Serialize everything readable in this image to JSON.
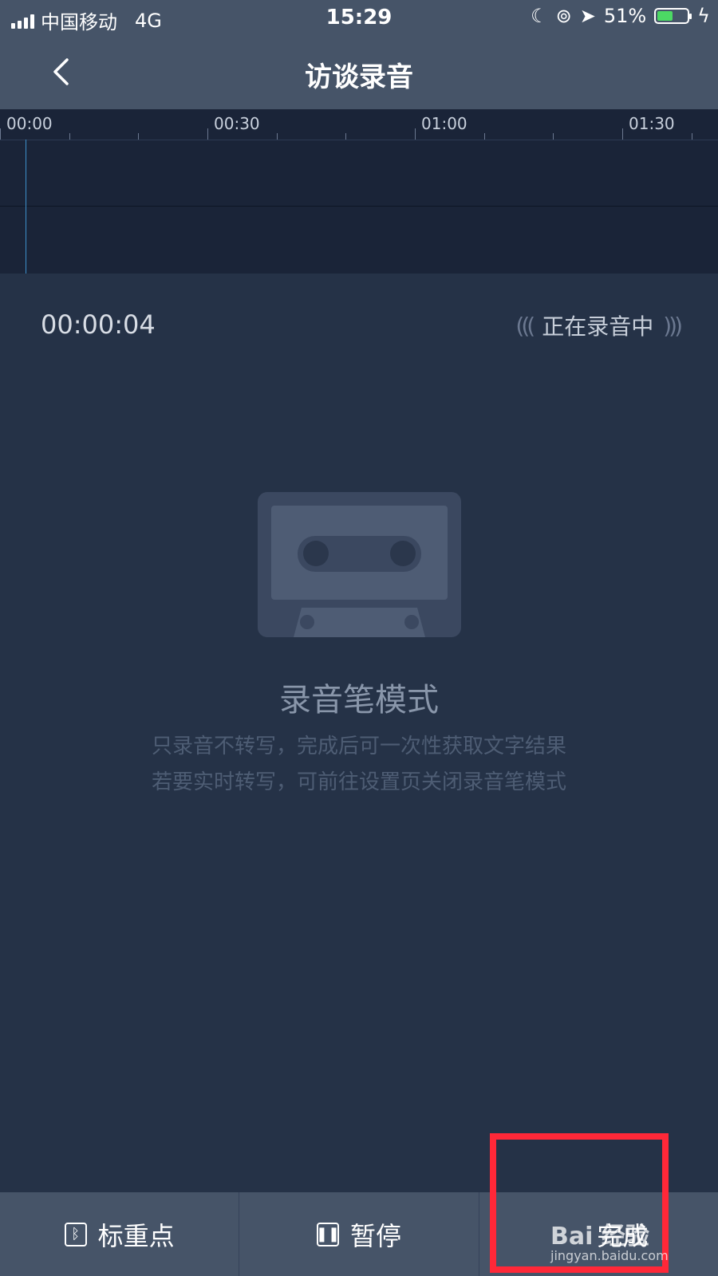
{
  "status": {
    "carrier": "中国移动",
    "network": "4G",
    "time": "15:29",
    "battery": "51%",
    "battery_level": 0.51
  },
  "nav": {
    "title": "访谈录音",
    "back_icon": "chevron-left-icon"
  },
  "timeline": {
    "labels": [
      "00:00",
      "00:30",
      "01:00",
      "01:30"
    ]
  },
  "recording": {
    "elapsed": "00:00:04",
    "status": "正在录音中"
  },
  "mode": {
    "title": "录音笔模式",
    "desc_line1": "只录音不转写，完成后可一次性获取文字结果",
    "desc_line2": "若要实时转写，可前往设置页关闭录音笔模式"
  },
  "bottom": {
    "mark_label": "标重点",
    "pause_label": "暂停",
    "done_label": "完成"
  },
  "watermark": {
    "text": "Bai 经验",
    "url": "jingyan.baidu.com"
  },
  "colors": {
    "accent_highlight": "#ff2838",
    "background": "#253247",
    "bar": "#465468"
  }
}
